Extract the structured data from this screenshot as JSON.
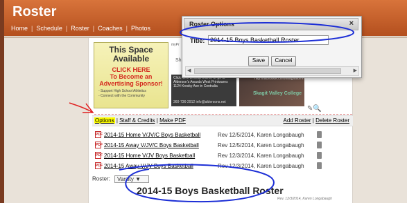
{
  "header": {
    "app_title": "Roster",
    "nav": [
      "Home",
      "Schedule",
      "Roster",
      "Coaches",
      "Photos"
    ]
  },
  "ads": {
    "advertise": {
      "line1": "This Space",
      "line2": "Available",
      "cta": "CLICK HERE",
      "cta2": "To Become an Advertising Sponsor!",
      "bullet1": "- Support High School Athletics",
      "bullet2": "- Connect with the Community"
    },
    "mypr": "myPr",
    "sh": "Sh",
    "aldersons": {
      "line1": "Click here to shop online, or go to",
      "line2": "Alderson's Awards West Printwares",
      "line3": "1124 Kresky Ave in Centralia",
      "phone": "360-736-2912   info@aldersons.net"
    },
    "skagit": {
      "url": "http://facebook.com/skagitalumni",
      "name": "Skagit Valley College"
    }
  },
  "options_bar": {
    "options": "Options",
    "staff_credits": "Staff & Credits",
    "make_pdf": "Make PDF",
    "add_roster": "Add Roster",
    "delete_roster": "Delete Roster"
  },
  "rosters": [
    {
      "title": "2014-15 Home V/JV/C Boys Basketball",
      "rev": "Rev 12/5/2014, Karen Longabaugh"
    },
    {
      "title": "2014-15 Away V/JV/C Boys Basketball",
      "rev": "Rev 12/5/2014, Karen Longabaugh"
    },
    {
      "title": "2014-15 Home V/JV Boys Basketball",
      "rev": "Rev 12/3/2014, Karen Longabaugh"
    },
    {
      "title": "2014-15 Away V/JV Boys Basketball",
      "rev": "Rev 12/3/2014, Karen Longabaugh"
    }
  ],
  "roster_select": {
    "label": "Roster:",
    "value": "Varsity"
  },
  "roster_heading": "2014-15 Boys Basketball Roster",
  "footer_rev": "Rev. 12/3/2014, Karen Longabaugh",
  "dialog": {
    "title": "Roster Options",
    "close": "×",
    "field_label": "Title:",
    "field_value": "2014-15 Boys Basketball Roster",
    "save": "Save",
    "cancel": "Cancel"
  },
  "colors": {
    "header": "#c85f2a",
    "annotation_blue": "#1d2fd6",
    "annotation_red": "#e02020",
    "highlight": "#ffff00"
  }
}
